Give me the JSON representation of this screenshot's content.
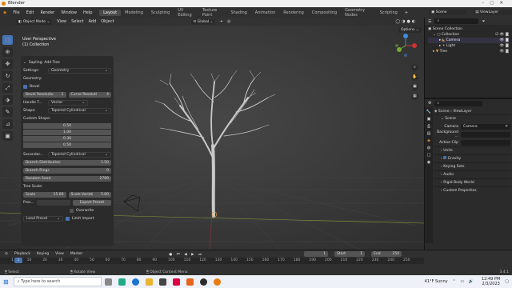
{
  "window": {
    "title": "Blender"
  },
  "menu": {
    "items": [
      "File",
      "Edit",
      "Render",
      "Window",
      "Help"
    ],
    "workspaces": [
      "Layout",
      "Modeling",
      "Sculpting",
      "UV Editing",
      "Texture Paint",
      "Shading",
      "Animation",
      "Rendering",
      "Compositing",
      "Geometry Nodes",
      "Scripting"
    ],
    "active_workspace": "Layout",
    "scene_label": "Scene",
    "viewlayer_label": "ViewLayer"
  },
  "viewport_header": {
    "mode": "Object Mode",
    "menus": [
      "View",
      "Select",
      "Add",
      "Object"
    ],
    "orientation": "Global",
    "options": "Options"
  },
  "viewport_info": {
    "line1": "User Perspective",
    "line2": "(1) Collection"
  },
  "sapling": {
    "title": "Sapling: Add Tree",
    "settings_label": "Settings:",
    "settings_value": "Geometry",
    "geometry_label": "Geometry:",
    "bevel_label": "Bevel",
    "bevel_res_label": "Bevel Resolutio",
    "bevel_res_value": "1",
    "curve_res_label": "Curve Resoluti",
    "curve_res_value": "4",
    "handle_label": "Handle T...",
    "handle_value": "Vector",
    "shape_label": "Shape:",
    "shape_value": "Tapered Cylindrical",
    "custom_shape_label": "Custom Shape:",
    "custom_shape_values": [
      "0.50",
      "1.00",
      "0.30",
      "0.50"
    ],
    "secondary_label": "Secondar...",
    "secondary_value": "Tapered Cylindrical",
    "branch_dist_label": "Branch Distribution",
    "branch_dist_value": "1.50",
    "branch_rings_label": "Branch Rings",
    "branch_rings_value": "0",
    "random_seed_label": "Random Seed",
    "random_seed_value": "2789",
    "tree_scale_label": "Tree Scale:",
    "scale_label": "Scale",
    "scale_value": "15.00",
    "scale_var_label": "Scale Variati",
    "scale_var_value": "5.00",
    "preset_label": "Pres...",
    "export_preset": "Export Preset",
    "overwrite": "Overwrite",
    "load_preset": "Load Preset",
    "limit_import": "Limit Import"
  },
  "outliner": {
    "root": "Scene Collection",
    "collection": "Collection",
    "items": [
      "Camera",
      "Light",
      "Tree"
    ]
  },
  "properties": {
    "scene_crumb": "Scene",
    "viewlayer_crumb": "ViewLayer",
    "section": "Scene",
    "camera_label": "Camera",
    "camera_value": "Camera",
    "background_label": "Background ...",
    "active_clip_label": "Active Clip",
    "sections": [
      "Units",
      "Gravity",
      "Keying Sets",
      "Audio",
      "Rigid Body World",
      "Custom Properties"
    ]
  },
  "timeline": {
    "menus": [
      "Playback",
      "Keying",
      "View",
      "Marker"
    ],
    "current_frame": "1",
    "start_label": "Start",
    "start_value": "1",
    "end_label": "End",
    "end_value": "250",
    "ticks": [
      "1",
      "10",
      "20",
      "30",
      "40",
      "50",
      "60",
      "70",
      "80",
      "90",
      "100",
      "110",
      "120",
      "130",
      "140",
      "150",
      "160",
      "170",
      "180",
      "190",
      "200",
      "210",
      "220",
      "230",
      "240",
      "250"
    ]
  },
  "statusbar": {
    "items": [
      "Select",
      "Rotate View",
      "Object Context Menu"
    ],
    "version": "3.4.1"
  },
  "taskbar": {
    "search_placeholder": "Type here to search",
    "weather": "41°F  Sunny",
    "time": "12:49 PM",
    "date": "2/3/2023"
  }
}
